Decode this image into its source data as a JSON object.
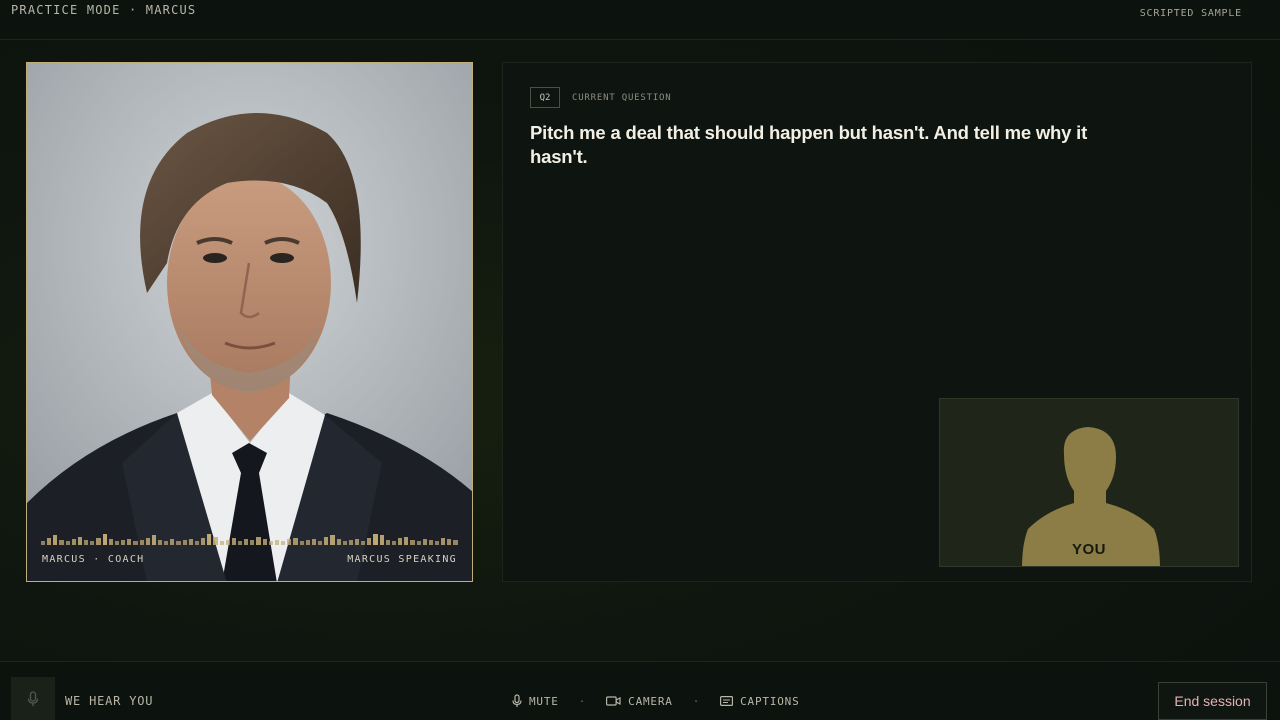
{
  "header": {
    "mode_label": "PRACTICE MODE · MARCUS",
    "sample_label": "SCRIPTED SAMPLE"
  },
  "coach": {
    "name_role": "MARCUS · COACH",
    "status": "MARCUS SPEAKING",
    "waveform_levels": [
      0.3,
      0.6,
      0.8,
      0.4,
      0.3,
      0.5,
      0.7,
      0.4,
      0.3,
      0.6,
      0.9,
      0.5,
      0.3,
      0.4,
      0.5,
      0.3,
      0.4,
      0.6,
      0.8,
      0.4,
      0.3,
      0.5,
      0.3,
      0.4,
      0.5,
      0.3,
      0.6,
      0.9,
      0.7,
      0.3,
      0.4,
      0.6,
      0.3,
      0.5,
      0.4,
      0.7,
      0.5,
      0.3,
      0.4,
      0.3,
      0.5,
      0.6,
      0.3,
      0.4,
      0.5,
      0.3,
      0.7,
      0.8,
      0.5,
      0.3,
      0.4,
      0.5,
      0.3,
      0.6,
      0.9,
      0.8,
      0.4,
      0.3,
      0.6,
      0.7,
      0.4,
      0.3,
      0.5,
      0.4,
      0.3,
      0.6,
      0.5,
      0.4
    ]
  },
  "question": {
    "number": "Q2",
    "label": "CURRENT QUESTION",
    "text": "Pitch me a deal that should happen but hasn't. And tell me why it hasn't."
  },
  "self_view": {
    "label": "YOU"
  },
  "footer": {
    "mic_status": "WE HEAR YOU",
    "controls": {
      "mute": "MUTE",
      "camera": "CAMERA",
      "captions": "CAPTIONS",
      "separator": "·"
    },
    "end_session": "End session"
  },
  "icons": {
    "mic": "microphone-icon",
    "camera": "video-camera-icon",
    "captions": "closed-captions-icon"
  },
  "colors": {
    "accent_gold": "#c4ad78",
    "end_session_text": "#e6b1b4",
    "background": "#0d130e"
  }
}
